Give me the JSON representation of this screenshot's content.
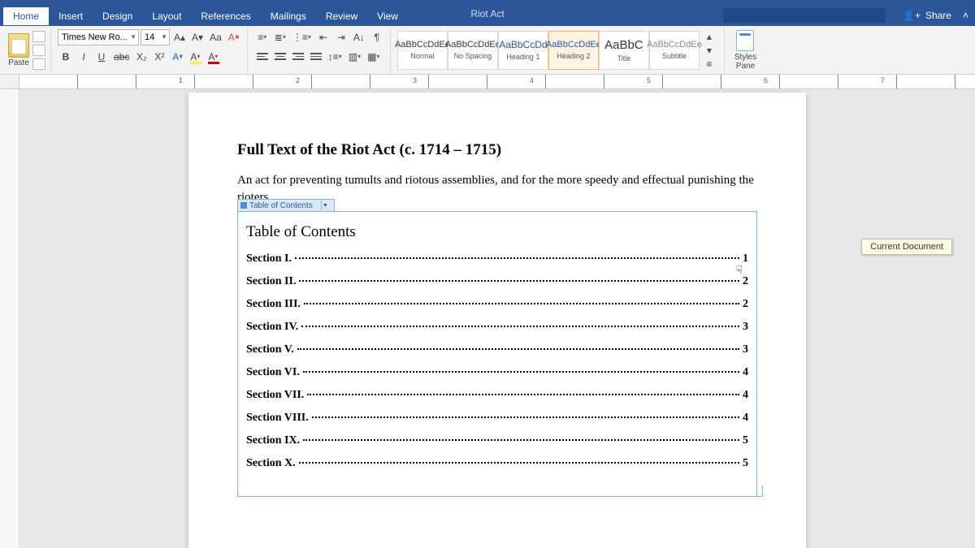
{
  "window": {
    "doc_title": "Riot Act"
  },
  "tabs": [
    "Home",
    "Insert",
    "Design",
    "Layout",
    "References",
    "Mailings",
    "Review",
    "View"
  ],
  "share": "Share",
  "font": {
    "name": "Times New Ro...",
    "size": "14"
  },
  "format_buttons": {
    "bold": "B",
    "italic": "I",
    "underline": "U",
    "strike": "abc",
    "sub": "X₂",
    "sup": "X²",
    "bigger": "A▴",
    "smaller": "A▾",
    "case": "Aa",
    "clear": "A⌫",
    "fontcolor": "A",
    "highlight": "A",
    "textfx": "A"
  },
  "clipboard": {
    "paste": "Paste"
  },
  "styles": [
    {
      "sample": "AaBbCcDdEe",
      "name": "Normal"
    },
    {
      "sample": "AaBbCcDdEe",
      "name": "No Spacing"
    },
    {
      "sample": "AaBbCcDd",
      "name": "Heading 1"
    },
    {
      "sample": "AaBbCcDdEe",
      "name": "Heading 2"
    },
    {
      "sample": "AaBbC",
      "name": "Title"
    },
    {
      "sample": "AaBbCcDdEe",
      "name": "Subtitle"
    }
  ],
  "styles_pane": "Styles\nPane",
  "ruler_numbers": [
    "1",
    "2",
    "3",
    "4",
    "5",
    "6",
    "7"
  ],
  "document": {
    "title": "Full Text of the Riot Act (c. 1714 – 1715)",
    "intro": "An act for preventing tumults and riotous assemblies, and for the more speedy and effectual punishing the rioters.",
    "toc_tab": "Table of Contents",
    "toc_heading": "Table of Contents",
    "toc": [
      {
        "label": "Section I.",
        "page": "1"
      },
      {
        "label": "Section II.",
        "page": "2"
      },
      {
        "label": "Section III.",
        "page": "2"
      },
      {
        "label": "Section IV.",
        "page": "3"
      },
      {
        "label": "Section V.",
        "page": "3"
      },
      {
        "label": "Section VI.",
        "page": "4"
      },
      {
        "label": "Section VII.",
        "page": "4"
      },
      {
        "label": "Section VIII.",
        "page": "4"
      },
      {
        "label": "Section IX.",
        "page": "5"
      },
      {
        "label": "Section X.",
        "page": "5"
      }
    ]
  },
  "tooltip": "Current Document"
}
